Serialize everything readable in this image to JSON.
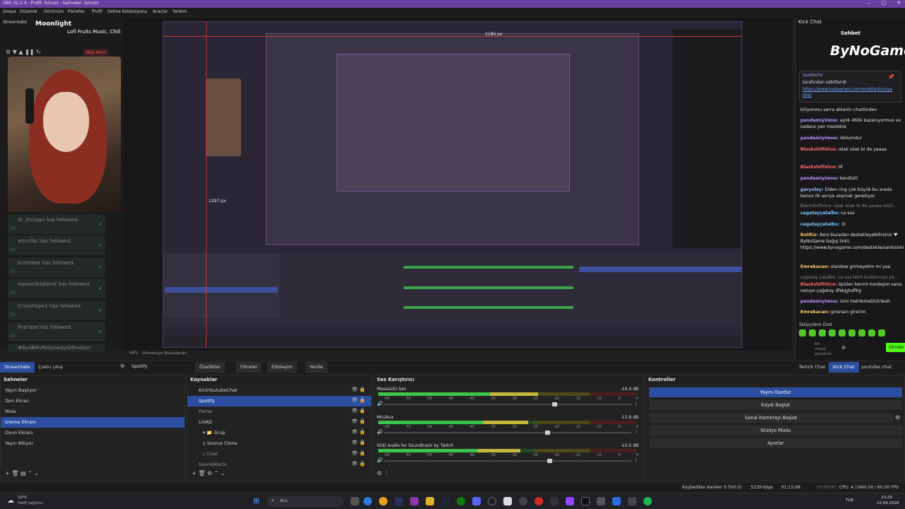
{
  "window": {
    "title": "OBS 32.0.4 - Profil: İsimsiz - Sahneler: İsimsiz"
  },
  "menu": [
    "Dosya",
    "Düzenle",
    "Görünüm",
    "Paneller",
    "Profil",
    "Sahne Koleksiyonu",
    "Araçlar",
    "Yardım"
  ],
  "overlay": {
    "app_name": "Streamlabs",
    "now_playing_title": "Moonlight",
    "now_playing_artist": "Lofi Fruits Music, Chill",
    "skip_alert": "Skip Alert",
    "follows": [
      {
        "name": "dr_zhivago",
        "suffix": "has followed.",
        "age": "5d"
      },
      {
        "name": "artcollip",
        "suffix": "has followed.",
        "age": "5d"
      },
      {
        "name": "kronhkee",
        "suffix": "has followed.",
        "age": "5d"
      },
      {
        "name": "AgnostikAdaruli",
        "suffix": "has followed.",
        "age": "5d"
      },
      {
        "name": "CrazyHope1",
        "suffix": "has followed.",
        "age": "5d"
      },
      {
        "name": "firariase",
        "suffix": "has followed.",
        "age": "5d"
      },
      {
        "name": "#BydBMyRekanAdyGittoAkon",
        "suffix": "",
        "age": ""
      }
    ],
    "measure_w": "2186 px",
    "measure_h": "1297 px",
    "zoom": "64%",
    "preview_label": "Pencereye Boyutlandır"
  },
  "dock_tabs_left": [
    "Streamlabs",
    "Çoklu çıkış"
  ],
  "dock_tabs_right": [
    "Twitch Chat",
    "Kick Chat",
    "youtube chat"
  ],
  "source_toolbar": {
    "source": "Spotify",
    "properties": "Özellikler",
    "filters": "Filtreler",
    "interact": "Etkileşim",
    "refresh": "Yenile"
  },
  "scenes": {
    "header": "Sahneler",
    "items": [
      "Yayın Başlıyor",
      "Tam Ekran",
      "Mola",
      "İzleme Ekranı",
      "Oyun Ekranı",
      "Yayın Bitiyor"
    ],
    "selected_index": 3
  },
  "sources": {
    "header": "Kaynaklar",
    "items": [
      {
        "label": "KickYoutubeChat",
        "indent": 0,
        "selected": false
      },
      {
        "label": "Spotify",
        "indent": 0,
        "selected": true
      },
      {
        "label": "Parrot",
        "indent": 0,
        "selected": false
      },
      {
        "label": "LIVAD",
        "indent": 0,
        "selected": false
      },
      {
        "label": "Grup",
        "indent": 1,
        "selected": false
      },
      {
        "label": "Source Clone",
        "indent": 2,
        "selected": false
      },
      {
        "label": "Chat",
        "indent": 2,
        "selected": false
      },
      {
        "label": "SoundAlerts",
        "indent": 0,
        "selected": false
      }
    ]
  },
  "mixer": {
    "header": "Ses Karıştırıcı",
    "channels": [
      {
        "name": "Masaüstü Ses",
        "db": "-10.4 dB",
        "level": 0.62,
        "volume": 0.68
      },
      {
        "name": "Mic/Aux",
        "db": "-11.6 dB",
        "level": 0.58,
        "volume": 0.65
      },
      {
        "name": "VOD Audio for Soundtrack by Twitch",
        "db": "-10.5 dB",
        "level": 0.55,
        "volume": 0.66
      }
    ],
    "ticks": [
      "-60",
      "-55",
      "-50",
      "-45",
      "-40",
      "-35",
      "-30",
      "-25",
      "-20",
      "-15",
      "-10",
      "-5",
      "0"
    ]
  },
  "controls": {
    "header": "Kontroller",
    "buttons": [
      "Yayını Durdur",
      "Kaydı Başlat",
      "Sanal Kamerayı Başlat",
      "Stüdyo Modu",
      "Ayarlar"
    ]
  },
  "chat": {
    "title": "Kick Chat",
    "subtitle": "Sohbet",
    "brand": "ByNoGame",
    "pinned_user": "Sankisimi",
    "pinned_text": "tarafından sabitlendi",
    "pinned_link": "https://www.instagram.com/eraktarkuruyemis/",
    "messages": [
      {
        "user": "",
        "text": "biliyonmu serra ablanin chattinden"
      },
      {
        "user": "pandamiyimne:",
        "text": "aylık 460k kazanıyormus ve sadece yan meslekle"
      },
      {
        "user": "pandamiyimne:",
        "text": "idolumdur"
      },
      {
        "user": "BlackshiftVice:",
        "text": "ıslak ıslak bi de yaaaa"
      },
      {
        "user": "BlackshiftVice:",
        "text": "öf"
      },
      {
        "user": "pandamiyimne:",
        "text": "kendisili"
      },
      {
        "user": "garyoley:",
        "text": "Elden ring çok büyük bu arada bence ilk seriye alışmak gerekiyor"
      },
      {
        "user": "",
        "text": "BlackshiftVice: ıslak ıslak bi de yaaaa İskili..."
      },
      {
        "user": "cagatayçatalbs:",
        "text": "La sus"
      },
      {
        "user": "cagatayçatalbs:",
        "text": ":D"
      },
      {
        "user": "BotRix:",
        "text": "Beni buradan destekleyebilirsiniz ♥ ByNoGame bağış linki; https://www.bynogame.com/destekle/sankisimi"
      },
      {
        "user": "Emrekacan:",
        "text": "stardew girmeyelim mi yaa"
      },
      {
        "user": "",
        "text": "çagatay çatalbs: La sus İskili kullanıcıya ya..."
      },
      {
        "user": "BlackshiftVice:",
        "text": "öpülen benim kardeşim sana noluyo çağatay dfskjghdfKg"
      },
      {
        "user": "pandamiyimne:",
        "text": "izmi HakYemeDickYeah"
      },
      {
        "user": "Emrekacan:",
        "text": "girersen girerim"
      }
    ],
    "followers_only": "Takipçilere Özel",
    "send": "Gönder",
    "placeholder": "Bir mesaj gönderin"
  },
  "status": {
    "dropped": "Kaybedilen Kareler 0 (%0.0)",
    "bitrate": "5239 kbps",
    "stream_time": "01:15:08",
    "rec_time": "00:00:00",
    "cpu": "CPU: 4.1%",
    "fps": "60.00 / 60.00 FPS"
  },
  "taskbar": {
    "weather_temp": "10°C",
    "weather_desc": "Hafif yağmur",
    "search": "Ara",
    "lang": "TUR",
    "time": "23:29",
    "date": "22.04.2026"
  },
  "colors": {
    "accent": "#2b4ea0",
    "titlebar": "#6b3fa0",
    "kick": "#53fc18"
  }
}
